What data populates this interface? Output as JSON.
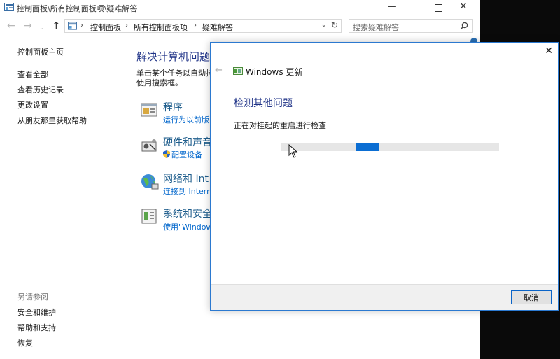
{
  "window": {
    "title": "控制面板\\所有控制面板项\\疑难解答",
    "minimize_glyph": "—",
    "close_glyph": "✕"
  },
  "nav": {
    "back_glyph": "←",
    "forward_glyph": "→",
    "recent_glyph": "⌄",
    "up_glyph": "↑",
    "breadcrumbs": [
      "控制面板",
      "所有控制面板项",
      "疑难解答"
    ],
    "separator": "›",
    "dropdown_glyph": "⌄",
    "refresh_glyph": "↻",
    "search_placeholder": "搜索疑难解答"
  },
  "sidebar": {
    "links": [
      "控制面板主页",
      "查看全部",
      "查看历史记录",
      "更改设置",
      "从朋友那里获取帮助"
    ],
    "see_also_heading": "另请参阅",
    "see_also_links": [
      "安全和维护",
      "帮助和支持",
      "恢复"
    ]
  },
  "main": {
    "title": "解决计算机问题",
    "description_lines": [
      "单击某个任务以自动排",
      "使用搜索框。"
    ],
    "categories": [
      {
        "title": "程序",
        "link": "运行为以前版",
        "icon": "programs-icon"
      },
      {
        "title": "硬件和声音",
        "link": "配置设备",
        "icon": "hardware-sound-icon"
      },
      {
        "title": "网络和 Int",
        "link": "连接到 Intern",
        "icon": "network-icon"
      },
      {
        "title": "系统和安全",
        "link": "使用\"Window",
        "icon": "system-security-icon"
      }
    ]
  },
  "dialog": {
    "close_glyph": "✕",
    "back_glyph": "←",
    "title": "Windows 更新",
    "heading": "检测其他问题",
    "status": "正在对挂起的重启进行检查",
    "progress": {
      "indeterminate": true,
      "chunk_offset_fraction": 0.34
    },
    "cancel_label": "取消"
  },
  "colors": {
    "accent": "#0b6ed3",
    "heading": "#1e3287",
    "link": "#0066cc",
    "dialog_border": "#2b79d0"
  }
}
